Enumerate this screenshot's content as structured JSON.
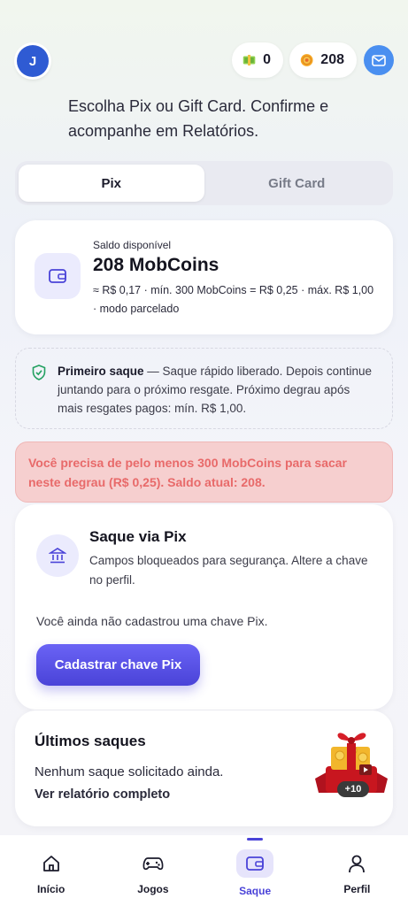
{
  "header": {
    "avatar_initial": "J",
    "cash_count": "0",
    "coin_count": "208",
    "cash_icon": "money-icon",
    "coin_icon": "coin-icon",
    "mail_icon": "mail-icon"
  },
  "intro": "Escolha Pix ou Gift Card. Confirme e acompanhe em Relatórios.",
  "tabs": [
    {
      "label": "Pix",
      "active": true
    },
    {
      "label": "Gift Card",
      "active": false
    }
  ],
  "balance": {
    "label": "Saldo disponível",
    "value": "208 MobCoins",
    "details": "≈ R$ 0,17 · mín. 300 MobCoins = R$ 0,25 · máx. R$ 1,00 · modo parcelado"
  },
  "notice": {
    "title": "Primeiro saque",
    "text": " — Saque rápido liberado. Depois continue juntando para o próximo resgate. Próximo degrau após mais resgates pagos: mín. R$ 1,00."
  },
  "alert": "Você precisa de pelo menos 300 MobCoins para sacar neste degrau (R$ 0,25). Saldo atual: 208.",
  "pix": {
    "title": "Saque via Pix",
    "description": "Campos bloqueados para segurança. Altere a chave no perfil.",
    "empty": "Você ainda não cadastrou uma chave Pix.",
    "button": "Cadastrar chave Pix"
  },
  "last": {
    "title": "Últimos saques",
    "empty": "Nenhum saque solicitado ainda.",
    "link": "Ver relatório completo",
    "reward_badge": "+10"
  },
  "nav": [
    {
      "label": "Início",
      "icon": "home-icon"
    },
    {
      "label": "Jogos",
      "icon": "gamepad-icon"
    },
    {
      "label": "Saque",
      "icon": "wallet-icon",
      "active": true
    },
    {
      "label": "Perfil",
      "icon": "user-icon"
    }
  ],
  "colors": {
    "accent": "#4a43d8",
    "alert_bg": "#f6cfcf",
    "alert_text": "#e86a6a",
    "mail": "#4a8ff0"
  }
}
